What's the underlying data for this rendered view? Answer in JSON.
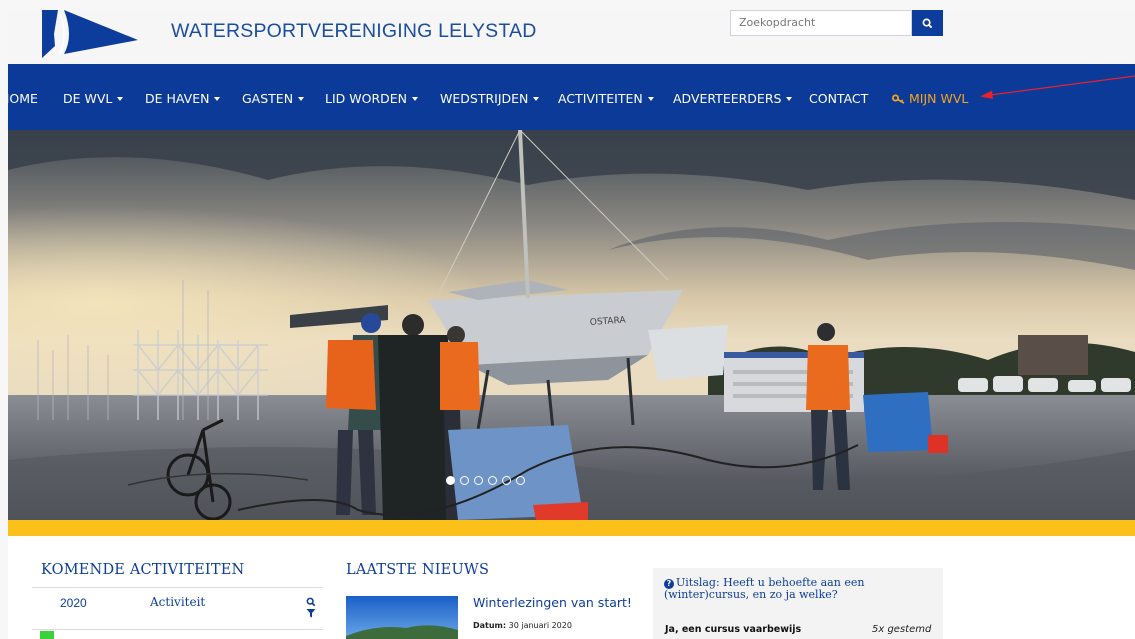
{
  "header": {
    "site_title": "WATERSPORTVERENIGING LELYSTAD",
    "search_placeholder": "Zoekopdracht"
  },
  "nav": {
    "items": [
      {
        "label": "HOME",
        "dropdown": false
      },
      {
        "label": "DE WVL",
        "dropdown": true
      },
      {
        "label": "DE HAVEN",
        "dropdown": true
      },
      {
        "label": "GASTEN",
        "dropdown": true
      },
      {
        "label": "LID WORDEN",
        "dropdown": true
      },
      {
        "label": "WEDSTRIJDEN",
        "dropdown": true
      },
      {
        "label": "ACTIVITEITEN",
        "dropdown": true
      },
      {
        "label": "ADVERTEERDERS",
        "dropdown": true
      },
      {
        "label": "CONTACT",
        "dropdown": false
      }
    ],
    "mijn_wvl": "MIJN WVL"
  },
  "slider": {
    "slide_count": 6,
    "active_slide": 1,
    "boat_name": "OSTARA"
  },
  "activities": {
    "title": "KOMENDE ACTIVITEITEN",
    "year": "2020",
    "column": "Activiteit"
  },
  "news": {
    "title": "LAATSTE NIEUWS",
    "item_title": "Winterlezingen van start!",
    "date_label": "Datum:",
    "date_value": "30 januari 2020"
  },
  "poll": {
    "question": "Uitslag: Heeft u behoefte aan een (winter)cursus, en zo ja welke?",
    "option": "Ja, een cursus vaarbewijs",
    "votes": "5x gestemd"
  },
  "colors": {
    "brand_blue": "#0b3a98",
    "accent_orange": "#f3a51d",
    "band_yellow": "#fbc019",
    "annotation_red": "#e8212b"
  }
}
